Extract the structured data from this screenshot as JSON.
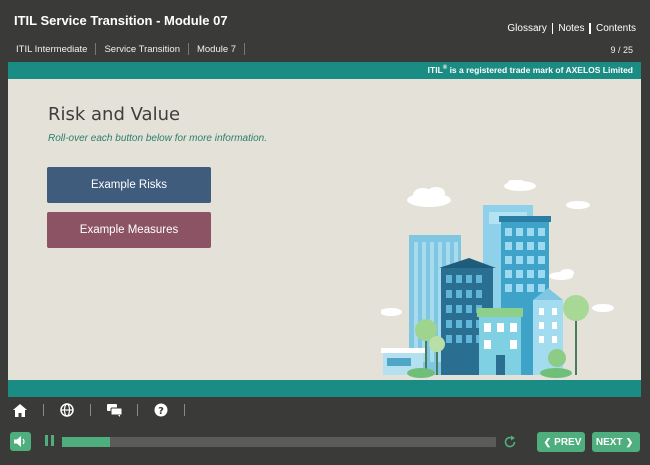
{
  "header": {
    "title": "ITIL Service Transition - Module 07",
    "links": [
      "Glossary",
      "Notes",
      "Contents"
    ]
  },
  "breadcrumb": [
    "ITIL Intermediate",
    "Service Transition",
    "Module 7"
  ],
  "page_counter": "9 / 25",
  "trademark": {
    "prefix": "ITIL",
    "mark": "®",
    "suffix": " is a registered trade mark of AXELOS Limited"
  },
  "slide": {
    "title": "Risk and Value",
    "subtitle": "Roll-over each button below for more information.",
    "buttons": [
      {
        "label": "Example Risks"
      },
      {
        "label": "Example Measures"
      }
    ]
  },
  "iconbar": [
    "home-icon",
    "globe-icon",
    "chat-icon",
    "help-icon"
  ],
  "player": {
    "progress": 0.11,
    "prev_label": "PREV",
    "next_label": "NEXT"
  },
  "colors": {
    "background": "#3a3b38",
    "teal": "#1b8c83",
    "accent_green": "#4fae7d",
    "slide_bg": "#e3e1d8",
    "button_risks": "#3f5c7d",
    "button_measures": "#8c5365"
  }
}
